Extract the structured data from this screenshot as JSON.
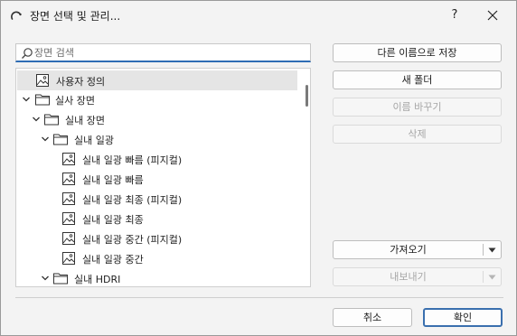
{
  "dialog": {
    "title": "장면 선택 및 관리...",
    "help_label": "?"
  },
  "search": {
    "placeholder": "장면 검색",
    "value": ""
  },
  "tree": [
    {
      "label": "사용자 정의",
      "type": "scene",
      "selected": true
    },
    {
      "label": "실사 장면",
      "type": "folder",
      "expanded": true
    },
    {
      "label": "실내 장면",
      "type": "folder",
      "expanded": true
    },
    {
      "label": "실내 일광",
      "type": "folder",
      "expanded": true
    },
    {
      "label": "실내 일광 빠름 (피지컬)",
      "type": "scene"
    },
    {
      "label": "실내 일광 빠름",
      "type": "scene"
    },
    {
      "label": "실내 일광 최종 (피지컬)",
      "type": "scene"
    },
    {
      "label": "실내 일광 최종",
      "type": "scene"
    },
    {
      "label": "실내 일광 중간 (피지컬)",
      "type": "scene"
    },
    {
      "label": "실내 일광 중간",
      "type": "scene"
    },
    {
      "label": "실내 HDRI",
      "type": "folder",
      "expanded": true
    }
  ],
  "actions": {
    "save_as": "다른 이름으로 저장",
    "new_folder": "새 폴더",
    "rename": "이름 바꾸기",
    "delete": "삭제",
    "import": "가져오기",
    "export": "내보내기"
  },
  "footer": {
    "cancel": "취소",
    "ok": "확인"
  },
  "colors": {
    "accent": "#2f6db5",
    "selection": "#e5e5e5",
    "disabled_text": "#a6a6a6"
  }
}
